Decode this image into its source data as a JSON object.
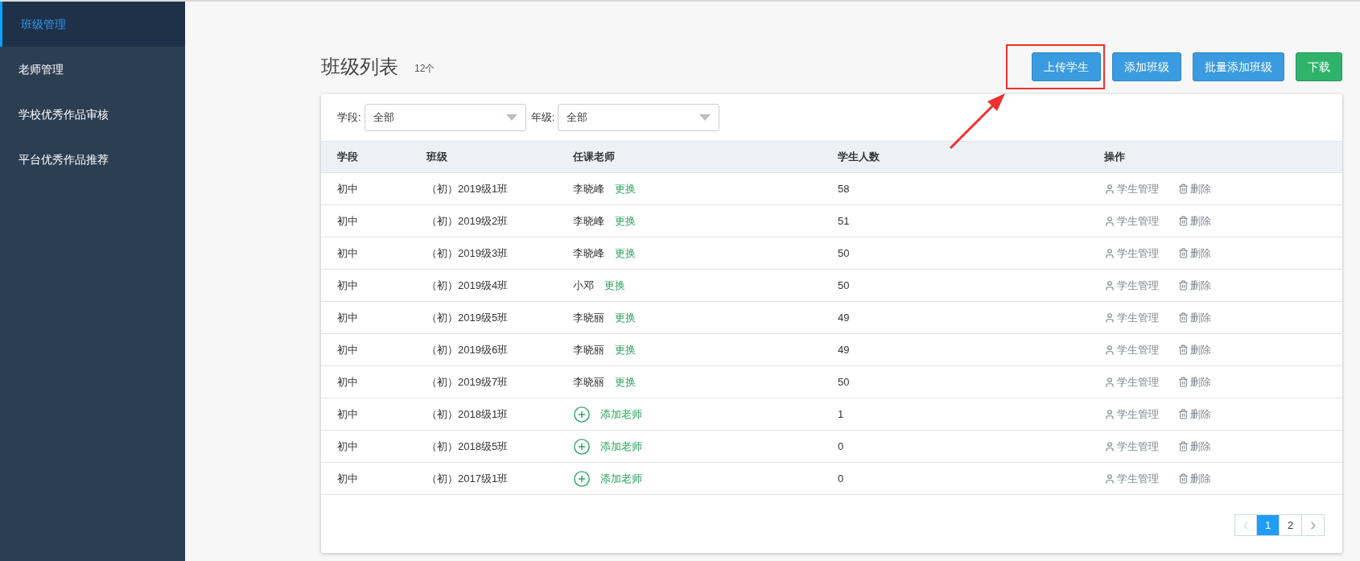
{
  "sidebar": {
    "items": [
      {
        "label": "班级管理",
        "selected": true
      },
      {
        "label": "老师管理",
        "selected": false
      },
      {
        "label": "学校优秀作品审核",
        "selected": false
      },
      {
        "label": "平台优秀作品推荐",
        "selected": false
      }
    ]
  },
  "header": {
    "title": "班级列表",
    "count": "12个",
    "buttons": [
      {
        "label": "上传学生",
        "kind": "primary",
        "highlighted": true
      },
      {
        "label": "添加班级",
        "kind": "primary",
        "highlighted": false
      },
      {
        "label": "批量添加班级",
        "kind": "primary",
        "highlighted": false
      },
      {
        "label": "下载",
        "kind": "success",
        "highlighted": false
      }
    ]
  },
  "filters": [
    {
      "label": "学段:",
      "value": "全部"
    },
    {
      "label": "年级:",
      "value": "全部"
    }
  ],
  "table": {
    "columns": [
      "学段",
      "班级",
      "任课老师",
      "学生人数",
      "操作"
    ],
    "rows": [
      {
        "stage": "初中",
        "class": "（初）2019级1班",
        "teacher": {
          "kind": "assigned",
          "name": "李晓峰",
          "action": "更换"
        },
        "students": "58",
        "actions": [
          "学生管理",
          "删除"
        ]
      },
      {
        "stage": "初中",
        "class": "（初）2019级2班",
        "teacher": {
          "kind": "assigned",
          "name": "李晓峰",
          "action": "更换"
        },
        "students": "51",
        "actions": [
          "学生管理",
          "删除"
        ]
      },
      {
        "stage": "初中",
        "class": "（初）2019级3班",
        "teacher": {
          "kind": "assigned",
          "name": "李晓峰",
          "action": "更换"
        },
        "students": "50",
        "actions": [
          "学生管理",
          "删除"
        ]
      },
      {
        "stage": "初中",
        "class": "（初）2019级4班",
        "teacher": {
          "kind": "assigned",
          "name": "小邓",
          "action": "更换"
        },
        "students": "50",
        "actions": [
          "学生管理",
          "删除"
        ]
      },
      {
        "stage": "初中",
        "class": "（初）2019级5班",
        "teacher": {
          "kind": "assigned",
          "name": "李晓丽",
          "action": "更换"
        },
        "students": "49",
        "actions": [
          "学生管理",
          "删除"
        ]
      },
      {
        "stage": "初中",
        "class": "（初）2019级6班",
        "teacher": {
          "kind": "assigned",
          "name": "李晓丽",
          "action": "更换"
        },
        "students": "49",
        "actions": [
          "学生管理",
          "删除"
        ]
      },
      {
        "stage": "初中",
        "class": "（初）2019级7班",
        "teacher": {
          "kind": "assigned",
          "name": "李晓丽",
          "action": "更换"
        },
        "students": "50",
        "actions": [
          "学生管理",
          "删除"
        ]
      },
      {
        "stage": "初中",
        "class": "（初）2018级1班",
        "teacher": {
          "kind": "none",
          "action": "添加老师"
        },
        "students": "1",
        "actions": [
          "学生管理",
          "删除"
        ]
      },
      {
        "stage": "初中",
        "class": "（初）2018级5班",
        "teacher": {
          "kind": "none",
          "action": "添加老师"
        },
        "students": "0",
        "actions": [
          "学生管理",
          "删除"
        ]
      },
      {
        "stage": "初中",
        "class": "（初）2017级1班",
        "teacher": {
          "kind": "none",
          "action": "添加老师"
        },
        "students": "0",
        "actions": [
          "学生管理",
          "删除"
        ]
      }
    ]
  },
  "pagination": {
    "prev_disabled": true,
    "pages": [
      {
        "label": "1",
        "selected": true
      },
      {
        "label": "2",
        "selected": false
      }
    ]
  }
}
